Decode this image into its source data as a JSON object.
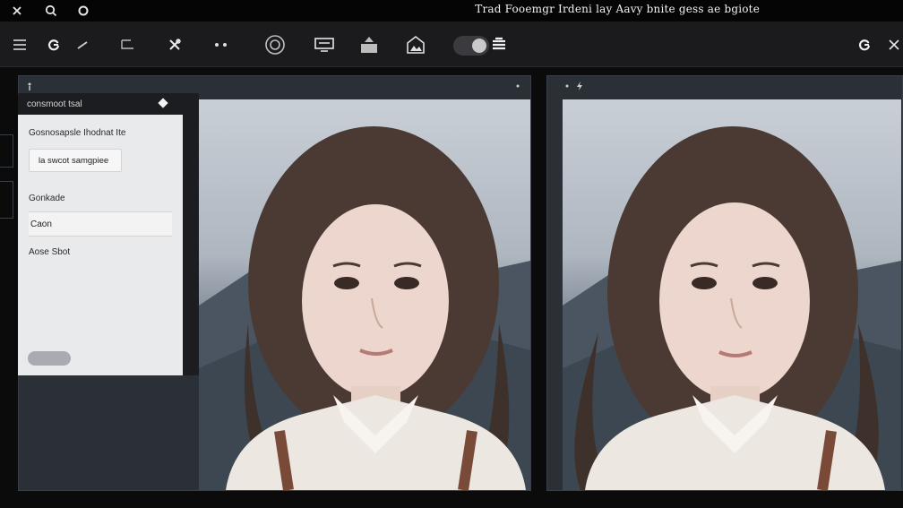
{
  "window": {
    "title": "Trad Fooemgr Irdeni lay Aavy bnite gess ae bgiote"
  },
  "dialog": {
    "header": "consmoot tsal",
    "section_label": "Gosnosapsle Ihodnat Ite",
    "button_label": "la swcot samgpiee",
    "field_label": "Gonkade",
    "field_value": "Caon",
    "note_label": "Aose Sbot"
  },
  "icons": {
    "topbar": [
      "close-x-icon",
      "search-icon",
      "circle-icon"
    ],
    "toolbar": [
      "menu-icon",
      "refresh-icon",
      "pen-icon",
      "crop-icon",
      "tools-icon",
      "more-icon",
      "target-icon",
      "monitor-icon",
      "upload-icon",
      "image-icon",
      "toggle",
      "layers-icon",
      "reload-icon",
      "expand-icon"
    ]
  },
  "colors": {
    "background": "#0b0b0c",
    "toolbar": "#1b1b1d",
    "panel": "#2b2f36",
    "dialog_body": "#e9eaec"
  }
}
